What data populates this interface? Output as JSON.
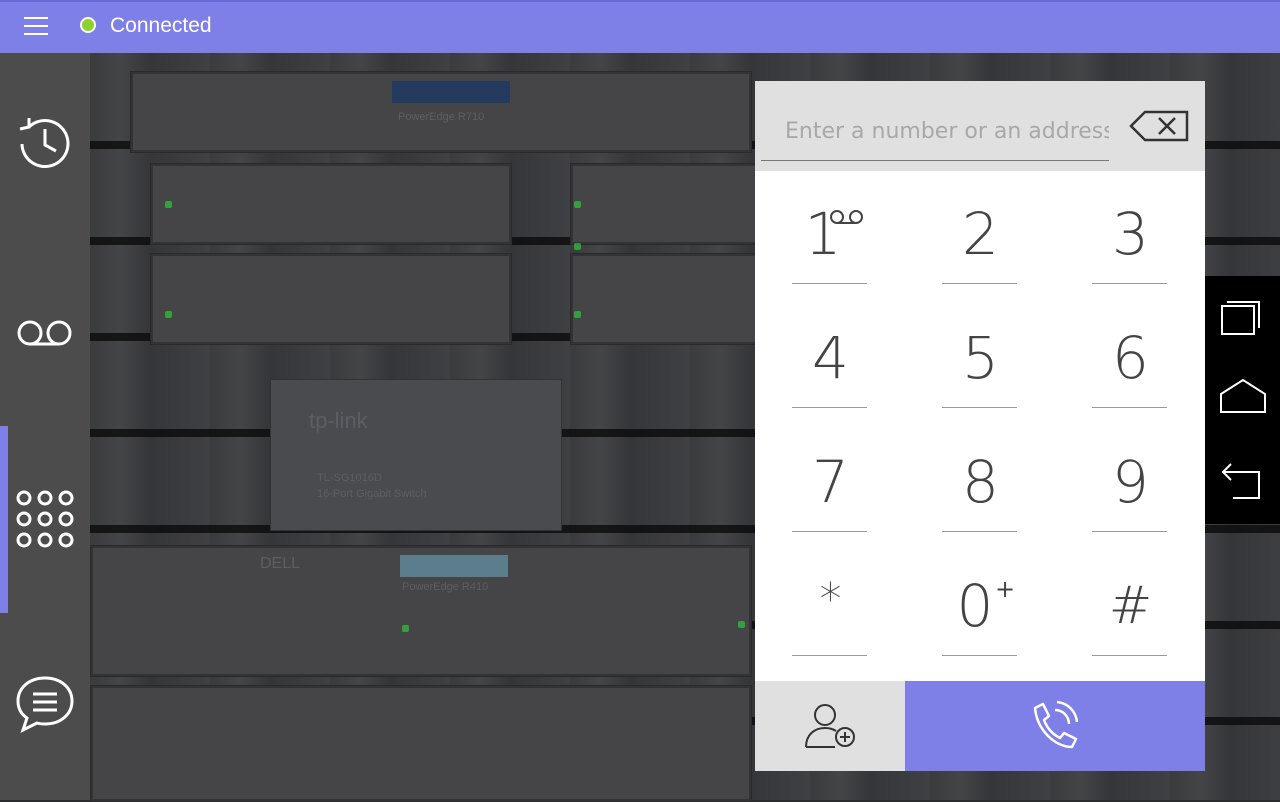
{
  "topbar": {
    "menu_icon": "hamburger-menu-icon",
    "status_dot_color": "#8ed12a",
    "status_text": "Connected",
    "accent_color": "#7f7fe8"
  },
  "siderail": {
    "items": [
      {
        "name": "history",
        "icon": "clock-icon",
        "active": false
      },
      {
        "name": "voicemail",
        "icon": "voicemail-icon",
        "active": false
      },
      {
        "name": "dialpad",
        "icon": "dialpad-icon",
        "active": true
      },
      {
        "name": "chat",
        "icon": "chat-bubble-icon",
        "active": false
      }
    ]
  },
  "background": {
    "rack_labels": [
      "PowerEdge R710",
      "tp-link",
      "TL-SG1016D",
      "16-Port Gigabit Switch",
      "DELL",
      "PowerEdge R410"
    ]
  },
  "dialer": {
    "address_placeholder": "Enter a number or an address",
    "address_value": "",
    "erase_icon": "backspace-icon",
    "keys": [
      {
        "digit": "1",
        "sup": "voicemail"
      },
      {
        "digit": "2",
        "sup": ""
      },
      {
        "digit": "3",
        "sup": ""
      },
      {
        "digit": "4",
        "sup": ""
      },
      {
        "digit": "5",
        "sup": ""
      },
      {
        "digit": "6",
        "sup": ""
      },
      {
        "digit": "7",
        "sup": ""
      },
      {
        "digit": "8",
        "sup": ""
      },
      {
        "digit": "9",
        "sup": ""
      },
      {
        "digit": "*",
        "sup": ""
      },
      {
        "digit": "0",
        "sup": "+"
      },
      {
        "digit": "#",
        "sup": ""
      }
    ],
    "add_contact_icon": "add-contact-icon",
    "call_icon": "phone-call-icon"
  },
  "system_nav": {
    "buttons": [
      "recent-apps-icon",
      "home-icon",
      "back-icon"
    ]
  }
}
